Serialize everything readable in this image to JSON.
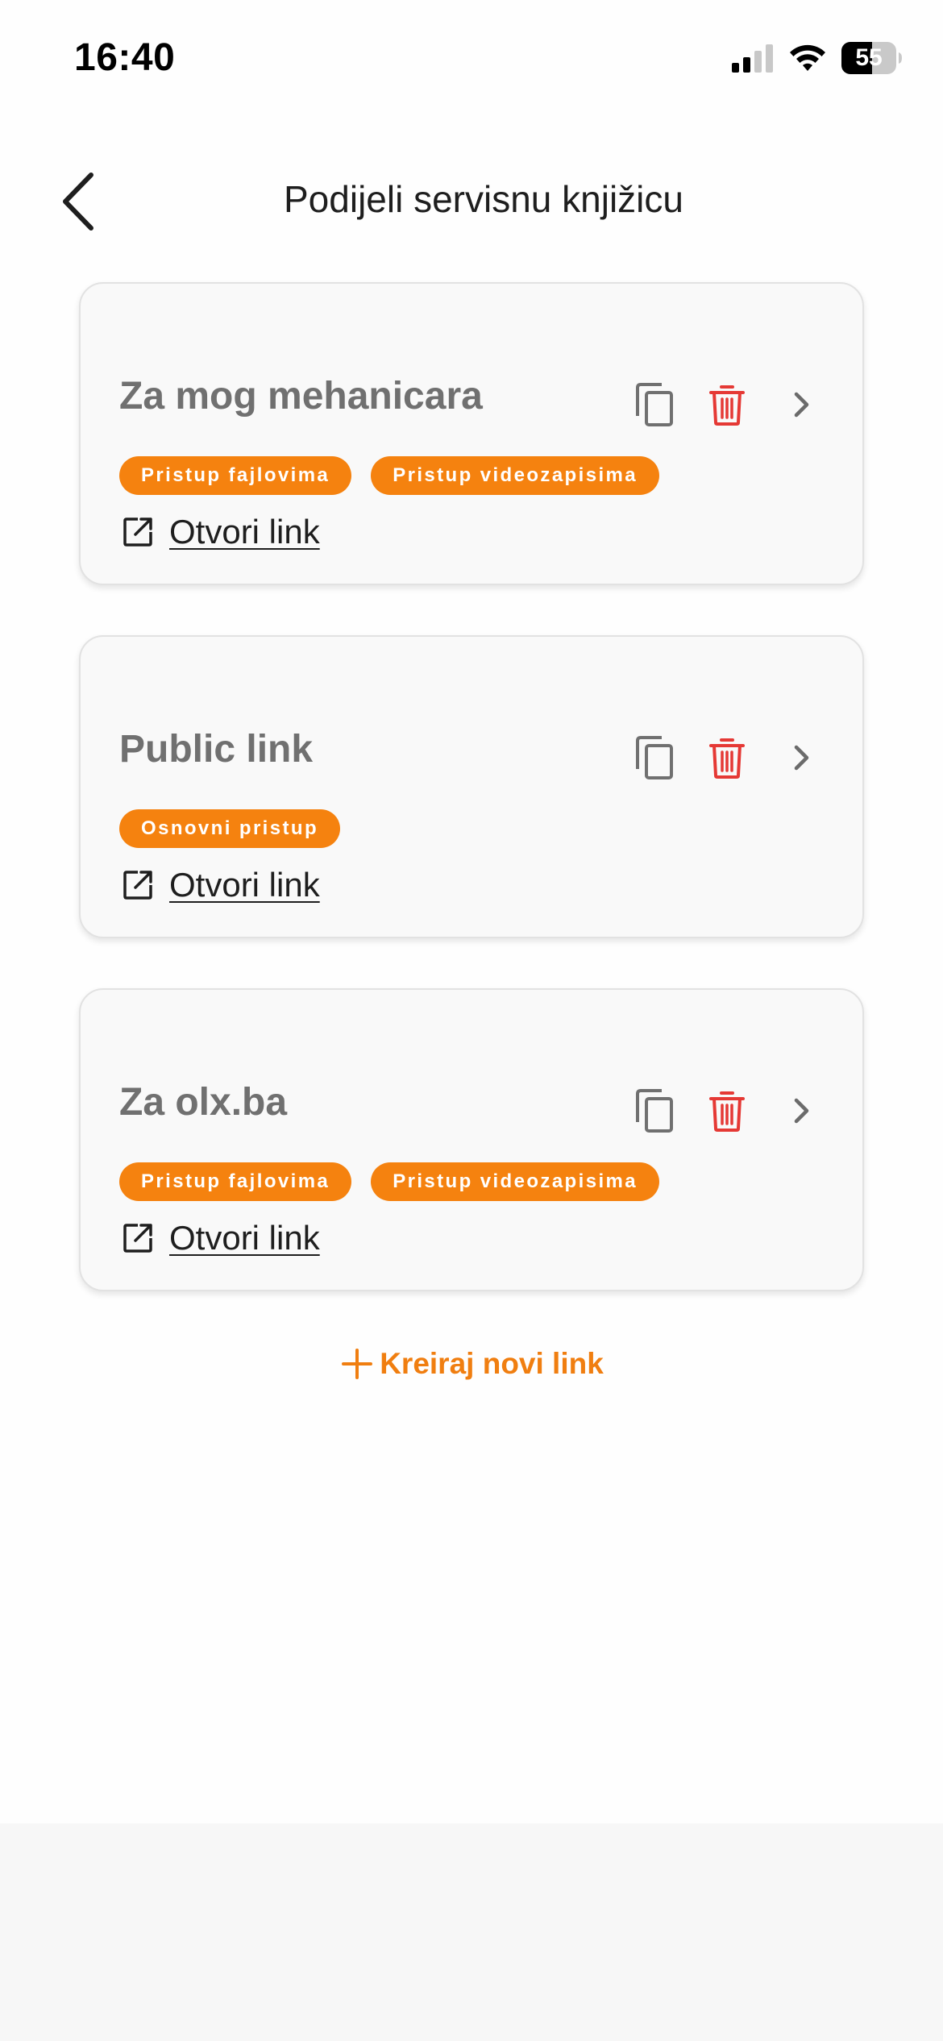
{
  "status_bar": {
    "time": "16:40",
    "battery_level": "55",
    "icons": [
      "signal-icon",
      "wifi-icon",
      "battery-icon"
    ]
  },
  "header": {
    "back_icon": "chevron-left-icon",
    "title": "Podijeli servisnu knjižicu"
  },
  "colors": {
    "accent": "#f5820f",
    "delete": "#e53935",
    "title_gray": "#707070",
    "card_bg": "#f9f9f9"
  },
  "cards": [
    {
      "title": "Za mog mehanicara",
      "tags": [
        "Pristup fajlovima",
        "Pristup videozapisima"
      ],
      "open_link_label": "Otvori link"
    },
    {
      "title": "Public link",
      "tags": [
        "Osnovni pristup"
      ],
      "open_link_label": "Otvori link"
    },
    {
      "title": "Za olx.ba",
      "tags": [
        "Pristup fajlovima",
        "Pristup videozapisima"
      ],
      "open_link_label": "Otvori link"
    }
  ],
  "create_link": {
    "label": "Kreiraj novi link",
    "icon": "plus-icon"
  }
}
